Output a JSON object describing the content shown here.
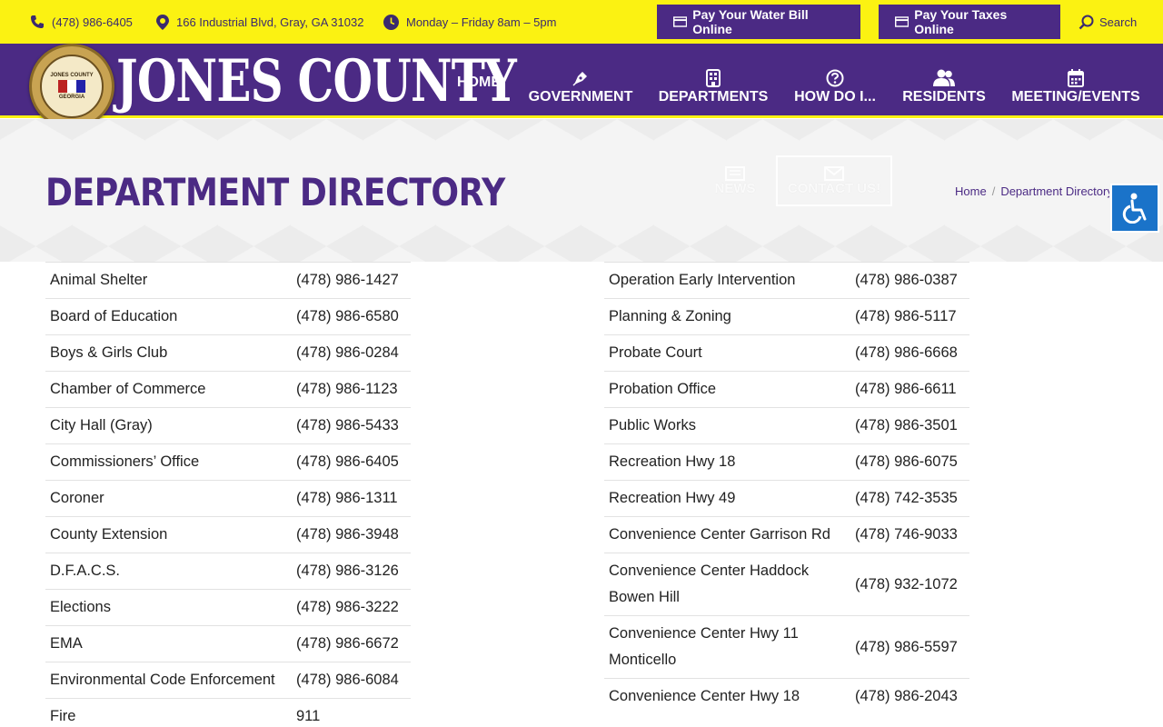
{
  "topbar": {
    "phone": "(478) 986-6405",
    "address": "166 Industrial Blvd, Gray, GA 31032",
    "hours": "Monday – Friday 8am – 5pm",
    "water_bill": "Pay Your Water Bill Online",
    "taxes": "Pay Your Taxes Online",
    "search": "Search"
  },
  "header": {
    "logo_text": "JONES COUNTY",
    "seal_top": "JONES COUNTY",
    "seal_bottom": "GEORGIA",
    "nav": [
      {
        "label": "HOME",
        "icon": "none"
      },
      {
        "label": "GOVERNMENT",
        "icon": "pen-nib-icon"
      },
      {
        "label": "DEPARTMENTS",
        "icon": "building-icon"
      },
      {
        "label": "HOW DO I...",
        "icon": "question-circle-icon"
      },
      {
        "label": "RESIDENTS",
        "icon": "users-icon"
      },
      {
        "label": "MEETING/EVENTS",
        "icon": "calendar-icon"
      }
    ]
  },
  "hero": {
    "title": "DEPARTMENT DIRECTORY",
    "news": "NEWS",
    "contact": "CONTACT US!",
    "breadcrumb_home": "Home",
    "breadcrumb_current": "Department Directory"
  },
  "directory": {
    "left": [
      {
        "name": "Animal Shelter",
        "phone": "(478) 986-1427"
      },
      {
        "name": "Board of Education",
        "phone": "(478) 986-6580"
      },
      {
        "name": "Boys & Girls Club",
        "phone": "(478) 986-0284"
      },
      {
        "name": "Chamber of Commerce",
        "phone": "(478) 986-1123"
      },
      {
        "name": "City Hall (Gray)",
        "phone": "(478) 986-5433"
      },
      {
        "name": "Commissioners’ Office",
        "phone": "(478) 986-6405"
      },
      {
        "name": "Coroner",
        "phone": "(478) 986-1311"
      },
      {
        "name": "County Extension",
        "phone": "(478) 986-3948"
      },
      {
        "name": "D.F.A.C.S.",
        "phone": "(478) 986-3126"
      },
      {
        "name": "Elections",
        "phone": "(478) 986-3222"
      },
      {
        "name": "EMA",
        "phone": "(478) 986-6672"
      },
      {
        "name": "Environmental Code Enforcement",
        "phone": "(478) 986-6084"
      },
      {
        "name": "Fire",
        "phone": "911"
      }
    ],
    "right": [
      {
        "name": "Operation Early Intervention",
        "phone": "(478) 986-0387"
      },
      {
        "name": "Planning & Zoning",
        "phone": "(478) 986-5117"
      },
      {
        "name": "Probate Court",
        "phone": "(478) 986-6668"
      },
      {
        "name": "Probation Office",
        "phone": "(478) 986-6611"
      },
      {
        "name": "Public Works",
        "phone": "(478) 986-3501"
      },
      {
        "name": "Recreation Hwy 18",
        "phone": "(478) 986-6075"
      },
      {
        "name": "Recreation Hwy 49",
        "phone": "(478) 742-3535"
      },
      {
        "name": "Convenience Center Garrison Rd",
        "phone": "(478) 746-9033"
      },
      {
        "name": "Convenience Center Haddock Bowen Hill",
        "phone": "(478) 932-1072"
      },
      {
        "name": "Convenience Center Hwy 11 Monticello",
        "phone": "(478) 986-5597"
      },
      {
        "name": "Convenience Center Hwy 18",
        "phone": "(478) 986-2043"
      }
    ]
  },
  "colors": {
    "yellow": "#fbf212",
    "purple": "#4b2a84",
    "access_blue": "#1a73c9"
  }
}
